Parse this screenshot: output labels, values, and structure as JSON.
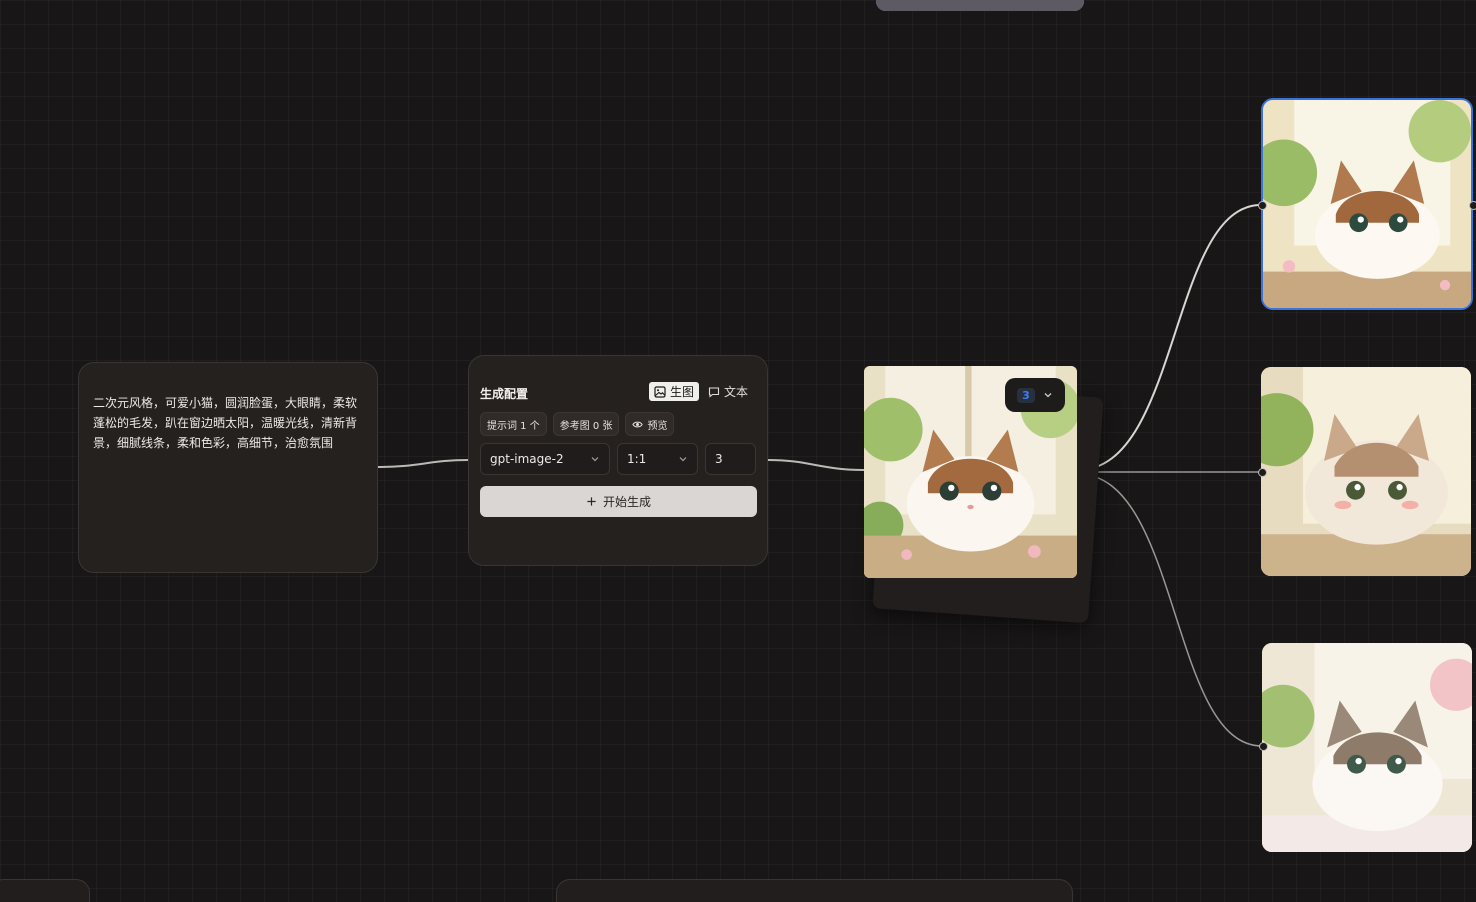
{
  "prompt_node": {
    "text": "二次元风格，可爱小猫，圆润脸蛋，大眼睛，柔软蓬松的毛发，趴在窗边晒太阳，温暖光线，清新背景，细腻线条，柔和色彩，高细节，治愈氛围"
  },
  "config_node": {
    "title": "生成配置",
    "tabs": [
      {
        "label": "生图",
        "icon": "image-icon",
        "active": true
      },
      {
        "label": "文本",
        "icon": "chat-icon",
        "active": false
      }
    ],
    "chips": {
      "prompt_count": "提示词 1 个",
      "reference_count": "参考图 0 张",
      "preview": "预览"
    },
    "model": "gpt-image-2",
    "ratio": "1:1",
    "count": "3",
    "generate_label": "开始生成"
  },
  "result_stack": {
    "count_badge": "3"
  },
  "colors": {
    "accent": "#3b73d8",
    "background": "#181616",
    "node": "#25211f"
  }
}
